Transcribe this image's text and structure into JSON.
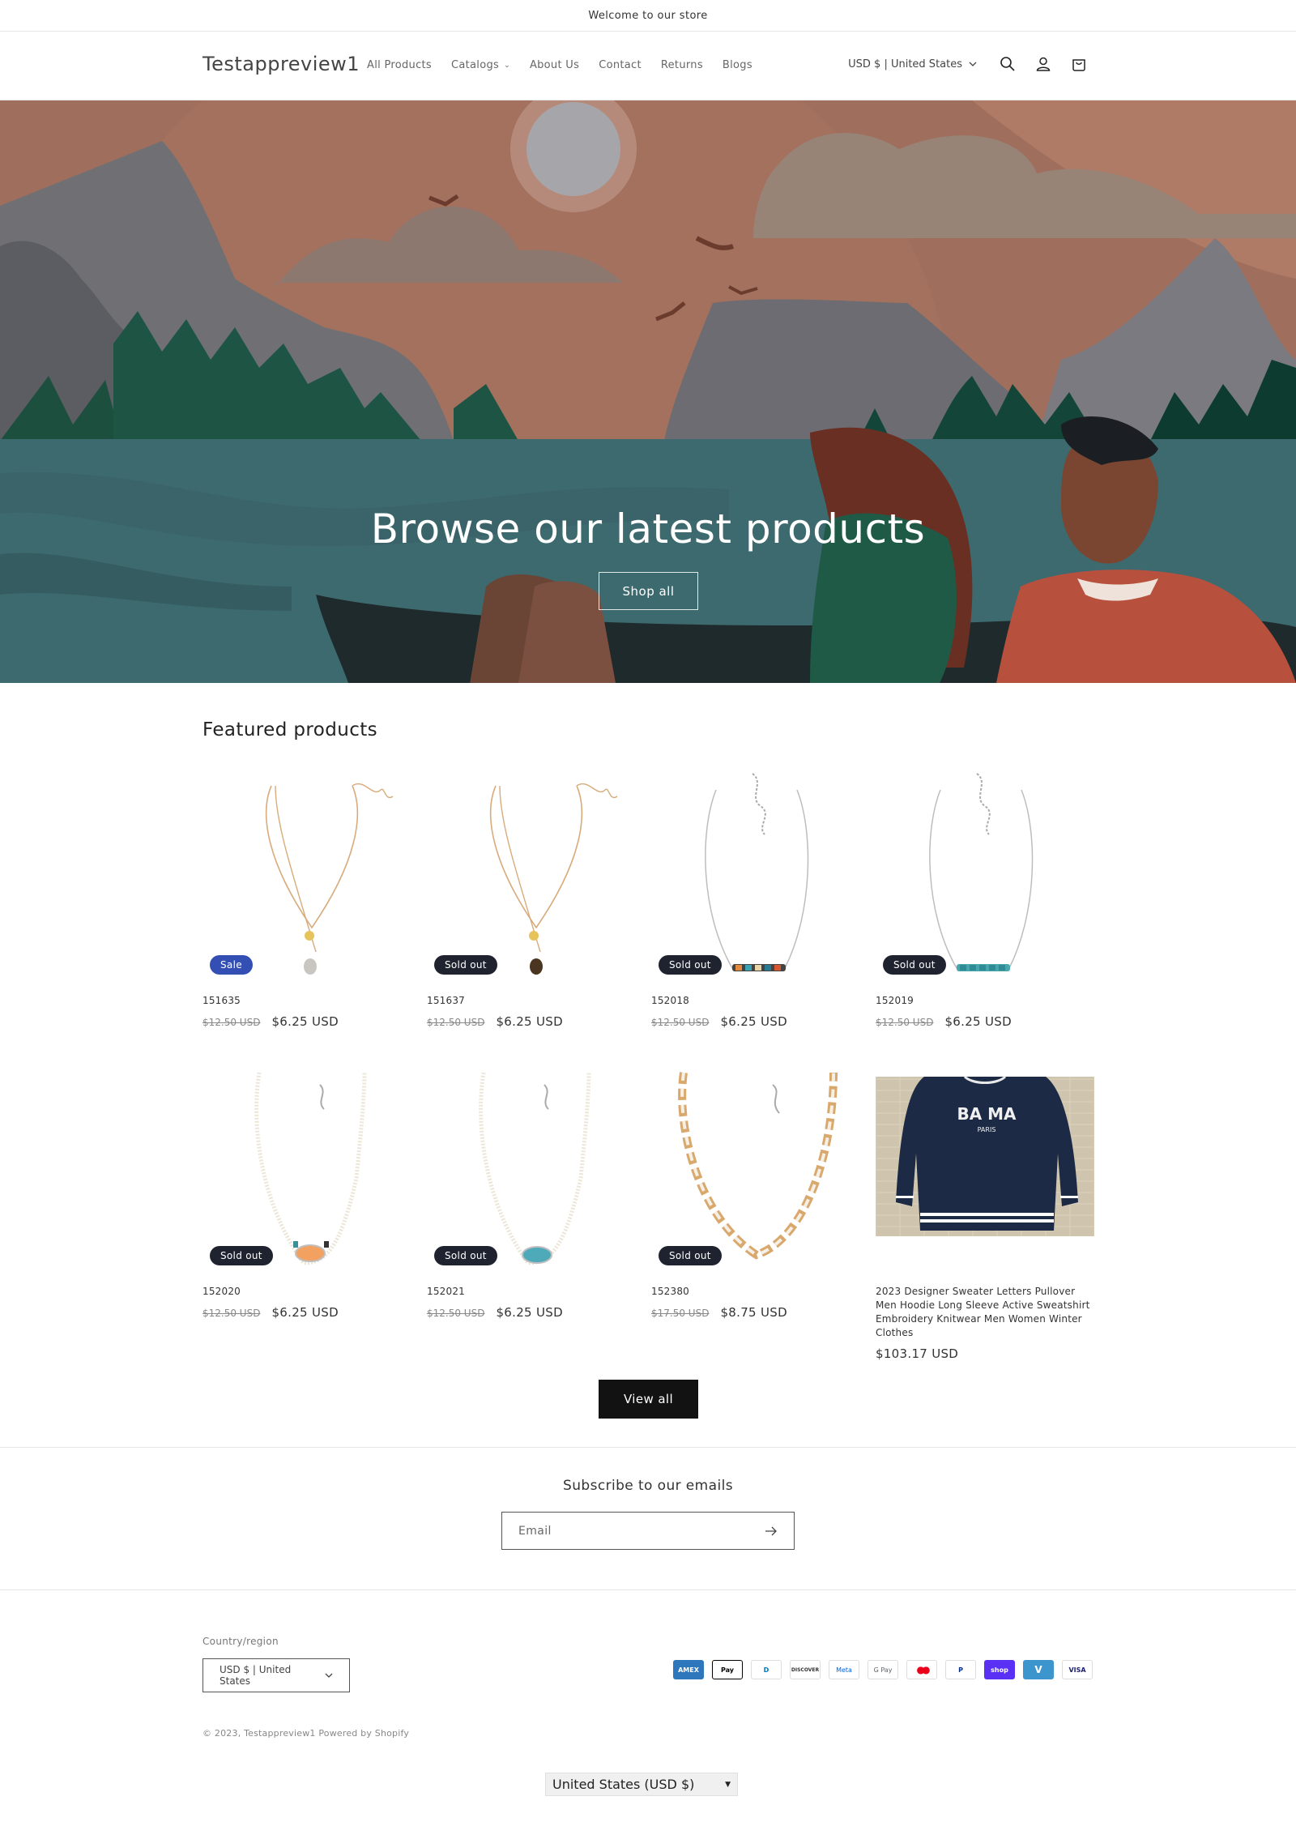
{
  "announcement": "Welcome to our store",
  "header": {
    "logo": "Testappreview1",
    "nav": [
      {
        "label": "All Products"
      },
      {
        "label": "Catalogs",
        "dropdown": true
      },
      {
        "label": "About Us"
      },
      {
        "label": "Contact"
      },
      {
        "label": "Returns"
      },
      {
        "label": "Blogs"
      }
    ],
    "currency": "USD $ | United States",
    "icons": [
      "search-icon",
      "account-icon",
      "cart-icon"
    ]
  },
  "hero": {
    "title": "Browse our latest products",
    "button": "Shop all"
  },
  "featured": {
    "title": "Featured products",
    "products": [
      {
        "name": "151635",
        "old_price": "$12.50 USD",
        "price": "$6.25 USD",
        "badge": "Sale",
        "badge_type": "sale",
        "image": "gold-necklace-grey-drop"
      },
      {
        "name": "151637",
        "old_price": "$12.50 USD",
        "price": "$6.25 USD",
        "badge": "Sold out",
        "badge_type": "soldout",
        "image": "gold-necklace-brown-drop"
      },
      {
        "name": "152018",
        "old_price": "$12.50 USD",
        "price": "$6.25 USD",
        "badge": "Sold out",
        "badge_type": "soldout",
        "image": "silver-necklace-multicolor-bar"
      },
      {
        "name": "152019",
        "old_price": "$12.50 USD",
        "price": "$6.25 USD",
        "badge": "Sold out",
        "badge_type": "soldout",
        "image": "silver-necklace-turquoise-bar"
      },
      {
        "name": "152020",
        "old_price": "$12.50 USD",
        "price": "$6.25 USD",
        "badge": "Sold out",
        "badge_type": "soldout",
        "image": "pearl-necklace-orange-pendant"
      },
      {
        "name": "152021",
        "old_price": "$12.50 USD",
        "price": "$6.25 USD",
        "badge": "Sold out",
        "badge_type": "soldout",
        "image": "pearl-necklace-turquoise-pendant"
      },
      {
        "name": "152380",
        "old_price": "$17.50 USD",
        "price": "$8.75 USD",
        "badge": "Sold out",
        "badge_type": "soldout",
        "image": "gold-chain-link-necklace"
      },
      {
        "name": "2023 Designer Sweater Letters Pullover Men Hoodie Long Sleeve Active Sweatshirt Embroidery Knitwear Men Women Winter Clothes",
        "old_price": "",
        "price": "$103.17 USD",
        "badge": "",
        "badge_type": "",
        "image": "navy-sweater",
        "sweater_text": "BA MA",
        "sweater_subtext": "PARIS"
      }
    ],
    "view_all": "View all"
  },
  "newsletter": {
    "title": "Subscribe to our emails",
    "placeholder": "Email"
  },
  "footer": {
    "country_label": "Country/region",
    "country_value": "USD $ | United States",
    "payments": [
      {
        "name": "AMEX",
        "bg": "#2e77bc",
        "fg": "#ffffff"
      },
      {
        "name": "Pay",
        "bg": "#ffffff",
        "fg": "#000000"
      },
      {
        "name": "D",
        "bg": "#ffffff",
        "fg": "#0079be"
      },
      {
        "name": "DISCOVER",
        "bg": "#ffffff",
        "fg": "#222222"
      },
      {
        "name": "Meta",
        "bg": "#ffffff",
        "fg": "#0064e0"
      },
      {
        "name": "G Pay",
        "bg": "#ffffff",
        "fg": "#5f6368"
      },
      {
        "name": "●●",
        "bg": "#ffffff",
        "fg": "#eb001b"
      },
      {
        "name": "P",
        "bg": "#ffffff",
        "fg": "#003087"
      },
      {
        "name": "shop",
        "bg": "#5a31f4",
        "fg": "#ffffff"
      },
      {
        "name": "V",
        "bg": "#3d95ce",
        "fg": "#ffffff"
      },
      {
        "name": "VISA",
        "bg": "#ffffff",
        "fg": "#1a1f71"
      }
    ],
    "copyright": "© 2023, Testappreview1 Powered by Shopify",
    "locale": "United States (USD $)"
  }
}
